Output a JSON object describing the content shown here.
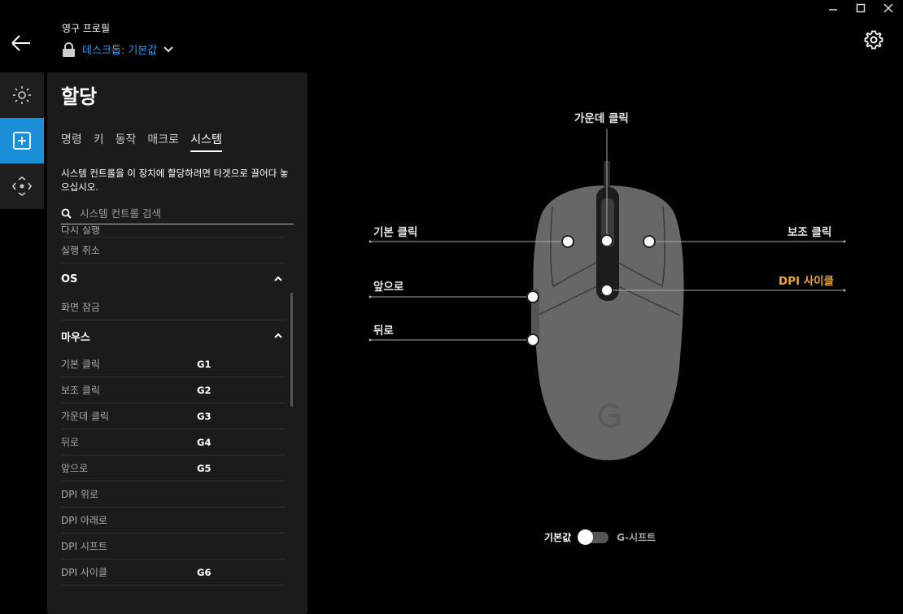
{
  "window": {
    "minimize_icon": "minimize-icon",
    "maximize_icon": "maximize-icon",
    "close_icon": "close-icon"
  },
  "header": {
    "profile_label": "영구 프로필",
    "profile_name": "데스크톱: 기본값"
  },
  "panel": {
    "title": "할당",
    "tabs": [
      "명령",
      "키",
      "동작",
      "매크로",
      "시스템"
    ],
    "active_tab": "시스템",
    "description": "시스템 컨트롤을 이 장치에 할당하려면 타겟으로 끌어다 놓으십시오.",
    "search_placeholder": "시스템 컨트롤 검색",
    "partial_row": "다시 실행",
    "row_undo": "실행 취소",
    "section_os": "OS",
    "row_lock": "화면 잠금",
    "section_mouse": "마우스",
    "mouse_rows": [
      {
        "label": "기본 클릭",
        "key": "G1"
      },
      {
        "label": "보조 클릭",
        "key": "G2"
      },
      {
        "label": "가운데 클릭",
        "key": "G3"
      },
      {
        "label": "뒤로",
        "key": "G4"
      },
      {
        "label": "앞으로",
        "key": "G5"
      },
      {
        "label": "DPI 위로",
        "key": ""
      },
      {
        "label": "DPI 아래로",
        "key": ""
      },
      {
        "label": "DPI 시프트",
        "key": ""
      },
      {
        "label": "DPI 사이클",
        "key": "G6"
      }
    ]
  },
  "mouse": {
    "middle_click": "가운데 클릭",
    "left_click": "기본 클릭",
    "right_click": "보조 클릭",
    "forward": "앞으로",
    "back": "뒤로",
    "dpi_cycle": "DPI 사이클",
    "accent_color": "#e8a53a"
  },
  "toggle": {
    "left_label": "기본값",
    "right_label": "G-시프트"
  }
}
